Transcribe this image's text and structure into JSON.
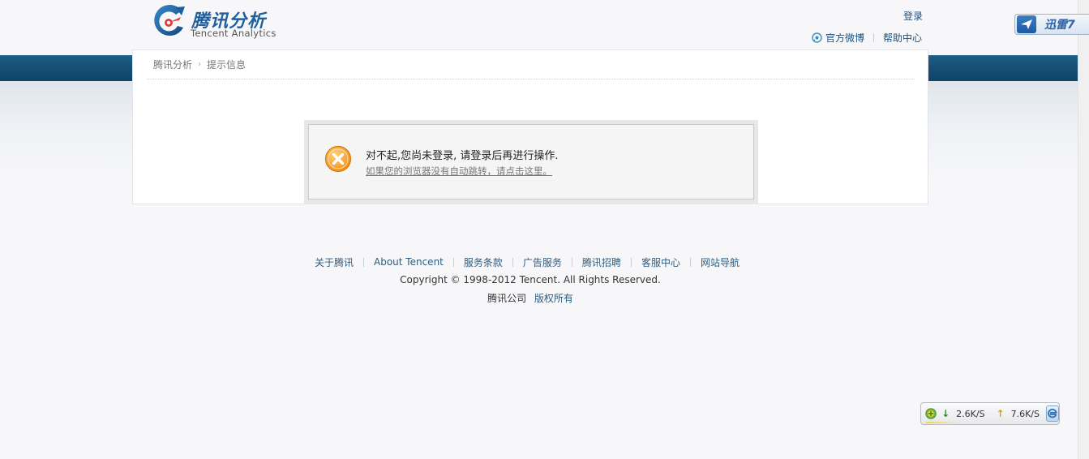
{
  "header": {
    "logo_cn": "腾讯分析",
    "logo_en": "Tencent Analytics",
    "login": "登录",
    "nav": [
      "官方微博",
      "帮助中心"
    ]
  },
  "breadcrumb": {
    "items": [
      "腾讯分析",
      "提示信息"
    ],
    "separator": "›"
  },
  "message": {
    "title": "对不起,您尚未登录, 请登录后再进行操作.",
    "redirect_link": "如果您的浏览器没有自动跳转，请点击这里。"
  },
  "footer": {
    "links": [
      "关于腾讯",
      "About Tencent",
      "服务条款",
      "广告服务",
      "腾讯招聘",
      "客服中心",
      "网站导航"
    ],
    "copyright": "Copyright © 1998-2012 Tencent. All Rights Reserved.",
    "company": "腾讯公司",
    "rights": "版权所有"
  },
  "xunlei": {
    "label": "迅雷7"
  },
  "speed_widget": {
    "down": "2.6K/S",
    "up": "7.6K/S"
  },
  "colors": {
    "header_band": "#174f74",
    "link": "#2d5d7e",
    "error_orange": "#f39a1e"
  }
}
